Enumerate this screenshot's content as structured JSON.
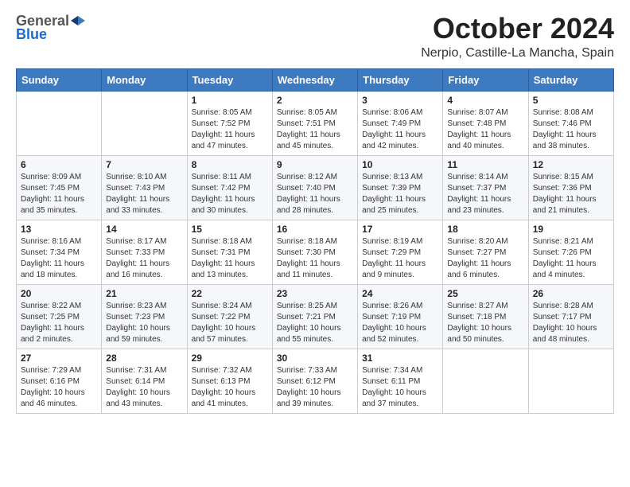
{
  "header": {
    "logo_general": "General",
    "logo_blue": "Blue",
    "title": "October 2024",
    "location": "Nerpio, Castille-La Mancha, Spain"
  },
  "columns": [
    "Sunday",
    "Monday",
    "Tuesday",
    "Wednesday",
    "Thursday",
    "Friday",
    "Saturday"
  ],
  "weeks": [
    [
      {
        "day": "",
        "info": ""
      },
      {
        "day": "",
        "info": ""
      },
      {
        "day": "1",
        "info": "Sunrise: 8:05 AM\nSunset: 7:52 PM\nDaylight: 11 hours and 47 minutes."
      },
      {
        "day": "2",
        "info": "Sunrise: 8:05 AM\nSunset: 7:51 PM\nDaylight: 11 hours and 45 minutes."
      },
      {
        "day": "3",
        "info": "Sunrise: 8:06 AM\nSunset: 7:49 PM\nDaylight: 11 hours and 42 minutes."
      },
      {
        "day": "4",
        "info": "Sunrise: 8:07 AM\nSunset: 7:48 PM\nDaylight: 11 hours and 40 minutes."
      },
      {
        "day": "5",
        "info": "Sunrise: 8:08 AM\nSunset: 7:46 PM\nDaylight: 11 hours and 38 minutes."
      }
    ],
    [
      {
        "day": "6",
        "info": "Sunrise: 8:09 AM\nSunset: 7:45 PM\nDaylight: 11 hours and 35 minutes."
      },
      {
        "day": "7",
        "info": "Sunrise: 8:10 AM\nSunset: 7:43 PM\nDaylight: 11 hours and 33 minutes."
      },
      {
        "day": "8",
        "info": "Sunrise: 8:11 AM\nSunset: 7:42 PM\nDaylight: 11 hours and 30 minutes."
      },
      {
        "day": "9",
        "info": "Sunrise: 8:12 AM\nSunset: 7:40 PM\nDaylight: 11 hours and 28 minutes."
      },
      {
        "day": "10",
        "info": "Sunrise: 8:13 AM\nSunset: 7:39 PM\nDaylight: 11 hours and 25 minutes."
      },
      {
        "day": "11",
        "info": "Sunrise: 8:14 AM\nSunset: 7:37 PM\nDaylight: 11 hours and 23 minutes."
      },
      {
        "day": "12",
        "info": "Sunrise: 8:15 AM\nSunset: 7:36 PM\nDaylight: 11 hours and 21 minutes."
      }
    ],
    [
      {
        "day": "13",
        "info": "Sunrise: 8:16 AM\nSunset: 7:34 PM\nDaylight: 11 hours and 18 minutes."
      },
      {
        "day": "14",
        "info": "Sunrise: 8:17 AM\nSunset: 7:33 PM\nDaylight: 11 hours and 16 minutes."
      },
      {
        "day": "15",
        "info": "Sunrise: 8:18 AM\nSunset: 7:31 PM\nDaylight: 11 hours and 13 minutes."
      },
      {
        "day": "16",
        "info": "Sunrise: 8:18 AM\nSunset: 7:30 PM\nDaylight: 11 hours and 11 minutes."
      },
      {
        "day": "17",
        "info": "Sunrise: 8:19 AM\nSunset: 7:29 PM\nDaylight: 11 hours and 9 minutes."
      },
      {
        "day": "18",
        "info": "Sunrise: 8:20 AM\nSunset: 7:27 PM\nDaylight: 11 hours and 6 minutes."
      },
      {
        "day": "19",
        "info": "Sunrise: 8:21 AM\nSunset: 7:26 PM\nDaylight: 11 hours and 4 minutes."
      }
    ],
    [
      {
        "day": "20",
        "info": "Sunrise: 8:22 AM\nSunset: 7:25 PM\nDaylight: 11 hours and 2 minutes."
      },
      {
        "day": "21",
        "info": "Sunrise: 8:23 AM\nSunset: 7:23 PM\nDaylight: 10 hours and 59 minutes."
      },
      {
        "day": "22",
        "info": "Sunrise: 8:24 AM\nSunset: 7:22 PM\nDaylight: 10 hours and 57 minutes."
      },
      {
        "day": "23",
        "info": "Sunrise: 8:25 AM\nSunset: 7:21 PM\nDaylight: 10 hours and 55 minutes."
      },
      {
        "day": "24",
        "info": "Sunrise: 8:26 AM\nSunset: 7:19 PM\nDaylight: 10 hours and 52 minutes."
      },
      {
        "day": "25",
        "info": "Sunrise: 8:27 AM\nSunset: 7:18 PM\nDaylight: 10 hours and 50 minutes."
      },
      {
        "day": "26",
        "info": "Sunrise: 8:28 AM\nSunset: 7:17 PM\nDaylight: 10 hours and 48 minutes."
      }
    ],
    [
      {
        "day": "27",
        "info": "Sunrise: 7:29 AM\nSunset: 6:16 PM\nDaylight: 10 hours and 46 minutes."
      },
      {
        "day": "28",
        "info": "Sunrise: 7:31 AM\nSunset: 6:14 PM\nDaylight: 10 hours and 43 minutes."
      },
      {
        "day": "29",
        "info": "Sunrise: 7:32 AM\nSunset: 6:13 PM\nDaylight: 10 hours and 41 minutes."
      },
      {
        "day": "30",
        "info": "Sunrise: 7:33 AM\nSunset: 6:12 PM\nDaylight: 10 hours and 39 minutes."
      },
      {
        "day": "31",
        "info": "Sunrise: 7:34 AM\nSunset: 6:11 PM\nDaylight: 10 hours and 37 minutes."
      },
      {
        "day": "",
        "info": ""
      },
      {
        "day": "",
        "info": ""
      }
    ]
  ]
}
